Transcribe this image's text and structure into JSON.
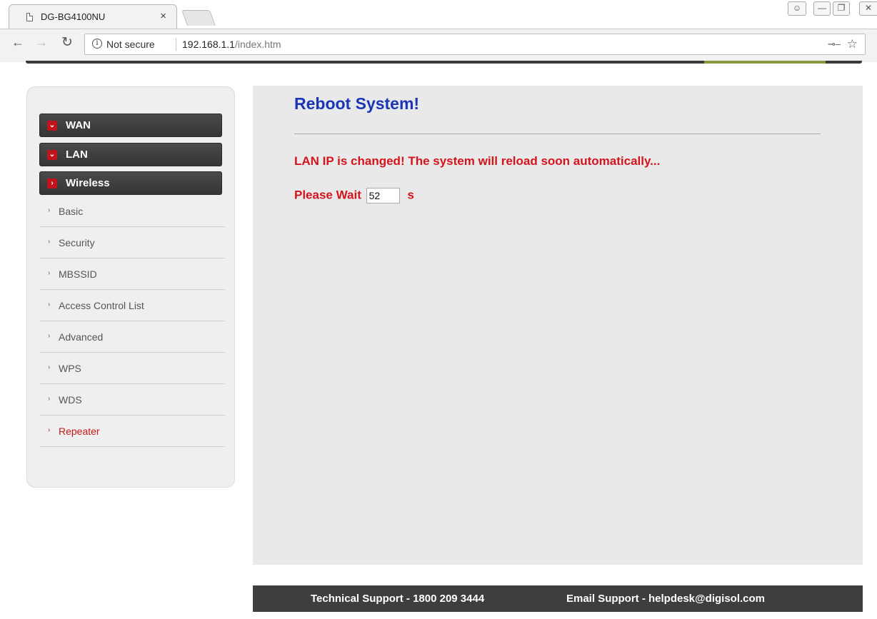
{
  "browser": {
    "tab_title": "DG-BG4100NU",
    "tab_close": "×",
    "security_label": "Not secure",
    "url_host": "192.168.1.1",
    "url_path": "/index.htm"
  },
  "sidebar": {
    "headers": [
      {
        "label": "WAN",
        "state": "collapsed"
      },
      {
        "label": "LAN",
        "state": "collapsed"
      },
      {
        "label": "Wireless",
        "state": "expanded"
      }
    ],
    "items": [
      {
        "label": "Basic"
      },
      {
        "label": "Security"
      },
      {
        "label": "MBSSID"
      },
      {
        "label": "Access Control List"
      },
      {
        "label": "Advanced"
      },
      {
        "label": "WPS"
      },
      {
        "label": "WDS"
      },
      {
        "label": "Repeater",
        "active": true
      }
    ]
  },
  "main": {
    "title": "Reboot System!",
    "message": "LAN IP is changed! The system will reload soon automatically...",
    "wait_label": "Please Wait",
    "wait_value": "52",
    "wait_unit": "s"
  },
  "footer": {
    "tech_support": "Technical Support - 1800 209 3444",
    "email_support": "Email Support - helpdesk@digisol.com"
  },
  "colors": {
    "title": "#1a35b5",
    "alert": "#d4141c",
    "menu_header": "#3a3a3a",
    "menu_arrow": "#c0141c",
    "active_item": "#c41a1a"
  }
}
